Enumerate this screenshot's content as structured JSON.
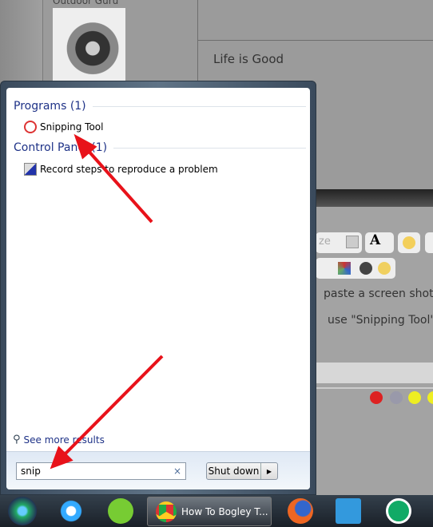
{
  "background_page": {
    "username": "Outdoor Guru",
    "post_text": "Life is Good",
    "editor_text_1": "paste a screen shot?",
    "editor_text_2": "use \"Snipping Tool\".",
    "font_size_placeholder": "ze"
  },
  "start_menu": {
    "groups": [
      {
        "title": "Programs (1)",
        "items": [
          {
            "label": "Snipping Tool",
            "icon": "scissors-icon"
          }
        ]
      },
      {
        "title": "Control Panel (1)",
        "items": [
          {
            "label": "Record steps to reproduce a problem",
            "icon": "steps-recorder-icon"
          }
        ]
      }
    ],
    "see_more": "See more results",
    "search_value": "snip",
    "clear_symbol": "×",
    "shutdown_label": "Shut down",
    "shutdown_arrow": "▶"
  },
  "taskbar": {
    "active_window": "How To Bogley T...",
    "icons": [
      "start-orb-icon",
      "internet-explorer-icon",
      "pear-app-icon",
      "chrome-icon",
      "firefox-icon",
      "on-screen-keyboard-icon",
      "utorrent-icon"
    ]
  },
  "colors": {
    "annotation_arrow": "#e8121a",
    "group_header": "#1e3287",
    "taskbar": "#1a2028"
  }
}
